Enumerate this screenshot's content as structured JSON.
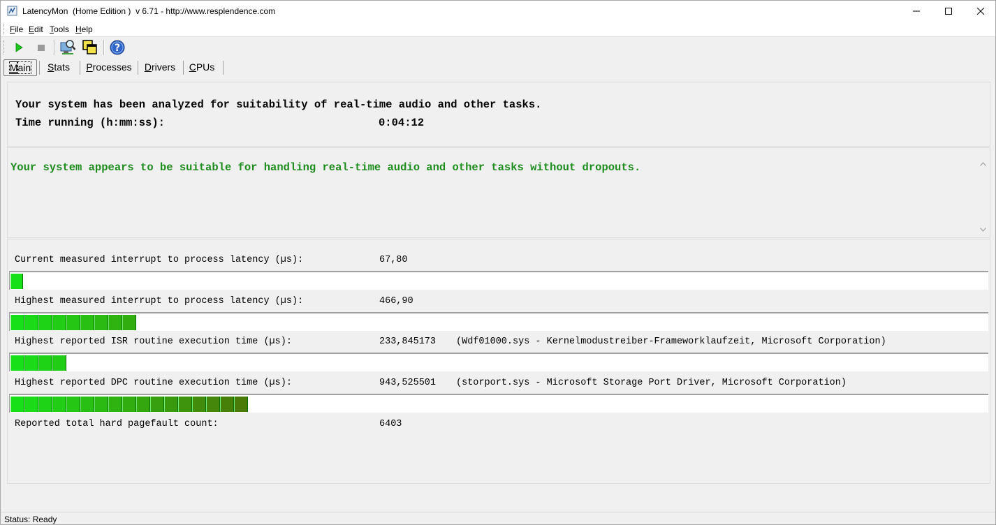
{
  "window": {
    "title": "LatencyMon  (Home Edition )  v 6.71 - http://www.resplendence.com"
  },
  "menu": [
    {
      "label": "File",
      "accel": "F",
      "rest": "ile"
    },
    {
      "label": "Edit",
      "accel": "E",
      "rest": "dit"
    },
    {
      "label": "Tools",
      "accel": "T",
      "rest": "ools"
    },
    {
      "label": "Help",
      "accel": "H",
      "rest": "elp"
    }
  ],
  "toolbar": {
    "icons": [
      "play-icon",
      "stop-icon",
      "analyze-icon",
      "windows-icon",
      "help-icon"
    ]
  },
  "tabs": [
    {
      "label": "Main",
      "accel": "M",
      "rest": "ain",
      "active": true
    },
    {
      "label": "Stats",
      "accel": "S",
      "rest": "tats",
      "active": false
    },
    {
      "label": "Processes",
      "accel": "P",
      "rest": "rocesses",
      "active": false
    },
    {
      "label": "Drivers",
      "accel": "D",
      "rest": "rivers",
      "active": false
    },
    {
      "label": "CPUs",
      "accel": "C",
      "rest": "PUs",
      "active": false
    }
  ],
  "summary": {
    "line1": "Your system has been analyzed for suitability of real-time audio and other tasks.",
    "time_label": "Time running (h:mm:ss):",
    "time_value": "0:04:12"
  },
  "verdict": {
    "text": "Your system appears to be suitable for handling real-time audio and other tasks without dropouts.",
    "color": "#1e8c1e"
  },
  "metrics": [
    {
      "label": "Current measured interrupt to process latency (µs):",
      "value": "67,80",
      "detail": "",
      "bar_segments": 1
    },
    {
      "label": "Highest measured interrupt to process latency (µs):",
      "value": "466,90",
      "detail": "",
      "bar_segments": 9
    },
    {
      "label": "Highest reported ISR routine execution time (µs):",
      "value": "233,845173",
      "detail": "(Wdf01000.sys - Kernelmodustreiber-Frameworklaufzeit, Microsoft Corporation)",
      "bar_segments": 4
    },
    {
      "label": "Highest reported DPC routine execution time (µs):",
      "value": "943,525501",
      "detail": "(storport.sys - Microsoft Storage Port Driver, Microsoft Corporation)",
      "bar_segments": 17
    },
    {
      "label": "Reported total hard pagefault count:",
      "value": "6403",
      "detail": "",
      "bar_segments": 0
    }
  ],
  "status": {
    "text": "Status: Ready"
  }
}
